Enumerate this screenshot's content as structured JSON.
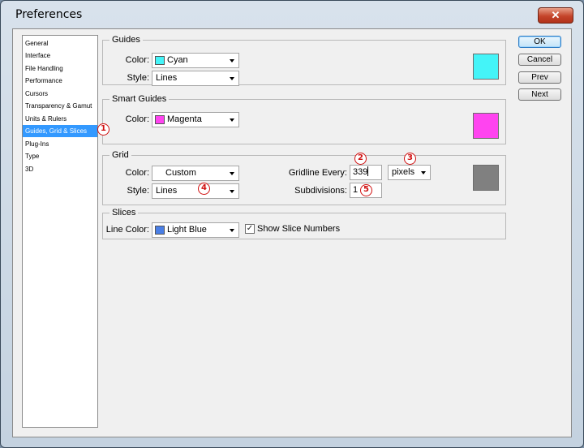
{
  "window": {
    "title": "Preferences",
    "close_glyph": "✕"
  },
  "nav": {
    "items": [
      "General",
      "Interface",
      "File Handling",
      "Performance",
      "Cursors",
      "Transparency & Gamut",
      "Units & Rulers",
      "Guides, Grid & Slices",
      "Plug-Ins",
      "Type",
      "3D"
    ],
    "selected_index": 7
  },
  "guides": {
    "label": "Guides",
    "color_label": "Color:",
    "color_value": "Cyan",
    "color_hex": "#44f4f8",
    "style_label": "Style:",
    "style_value": "Lines"
  },
  "smart_guides": {
    "label": "Smart Guides",
    "color_label": "Color:",
    "color_value": "Magenta",
    "color_hex": "#ff44f0"
  },
  "grid": {
    "label": "Grid",
    "color_label": "Color:",
    "color_value": "Custom",
    "color_hex": "#808080",
    "style_label": "Style:",
    "style_value": "Lines",
    "gridline_label": "Gridline Every:",
    "gridline_value": "339",
    "unit_value": "pixels",
    "subdivisions_label": "Subdivisions:",
    "subdivisions_value": "1"
  },
  "slices": {
    "label": "Slices",
    "line_color_label": "Line Color:",
    "line_color_value": "Light Blue",
    "line_color_hex": "#4a7fe6",
    "show_numbers_label": "Show Slice Numbers",
    "show_numbers_checked": true,
    "check_glyph": "✓"
  },
  "buttons": {
    "ok": "OK",
    "cancel": "Cancel",
    "prev": "Prev",
    "next": "Next"
  },
  "annotations": [
    "1",
    "2",
    "3",
    "4",
    "5"
  ]
}
